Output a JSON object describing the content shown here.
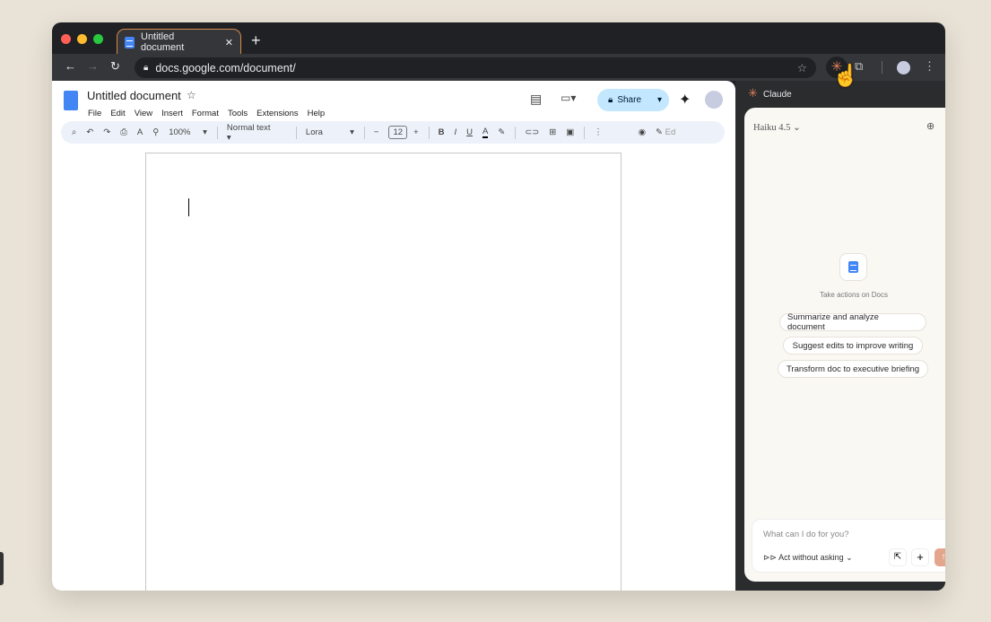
{
  "browser": {
    "tab_title": "Untitled document",
    "url": "docs.google.com/document/"
  },
  "docs": {
    "title": "Untitled document",
    "menu": [
      "File",
      "Edit",
      "View",
      "Insert",
      "Format",
      "Tools",
      "Extensions",
      "Help"
    ],
    "share_label": "Share",
    "zoom": "100%",
    "style": "Normal text",
    "font": "Lora",
    "font_size": "12",
    "edit_label": "Ed"
  },
  "claude": {
    "header": "Claude",
    "model": "Haiku 4.5",
    "empty_caption": "Take actions on Docs",
    "suggestions": [
      "Summarize and analyze document",
      "Suggest edits to improve writing",
      "Transform doc to executive briefing"
    ],
    "input_placeholder": "What can I do for you?",
    "mode": "Act without asking"
  }
}
